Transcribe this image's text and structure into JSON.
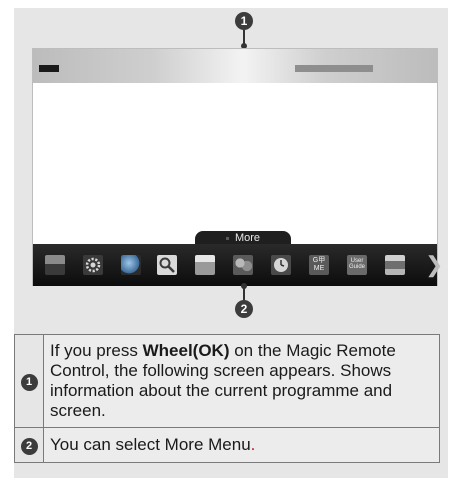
{
  "markers": {
    "top": "1",
    "bottom": "2"
  },
  "tv": {
    "more_label": "More",
    "launcher_icons": [
      "settings-icon",
      "gear-icon",
      "globe-icon",
      "search-icon",
      "tv-guide-icon",
      "photos-icon",
      "clock-icon",
      "game-icon",
      "user-guide-icon",
      "input-icon"
    ],
    "user_guide_line1": "User",
    "user_guide_line2": "Guide",
    "game_glyph": "G甲ME"
  },
  "table": {
    "row1": {
      "number": "1",
      "before": "If you press ",
      "bold": "Wheel(OK)",
      "after": " on the Magic Remote Control, the following screen appears. Shows information about the current programme and screen."
    },
    "row2": {
      "number": "2",
      "text": "You can select More Menu",
      "end": "."
    }
  },
  "colors": {
    "panel": "#e6e6e6",
    "marker": "#3c3c3c",
    "launcher": "#1a1a1a",
    "accent_period": "#c8102e"
  }
}
